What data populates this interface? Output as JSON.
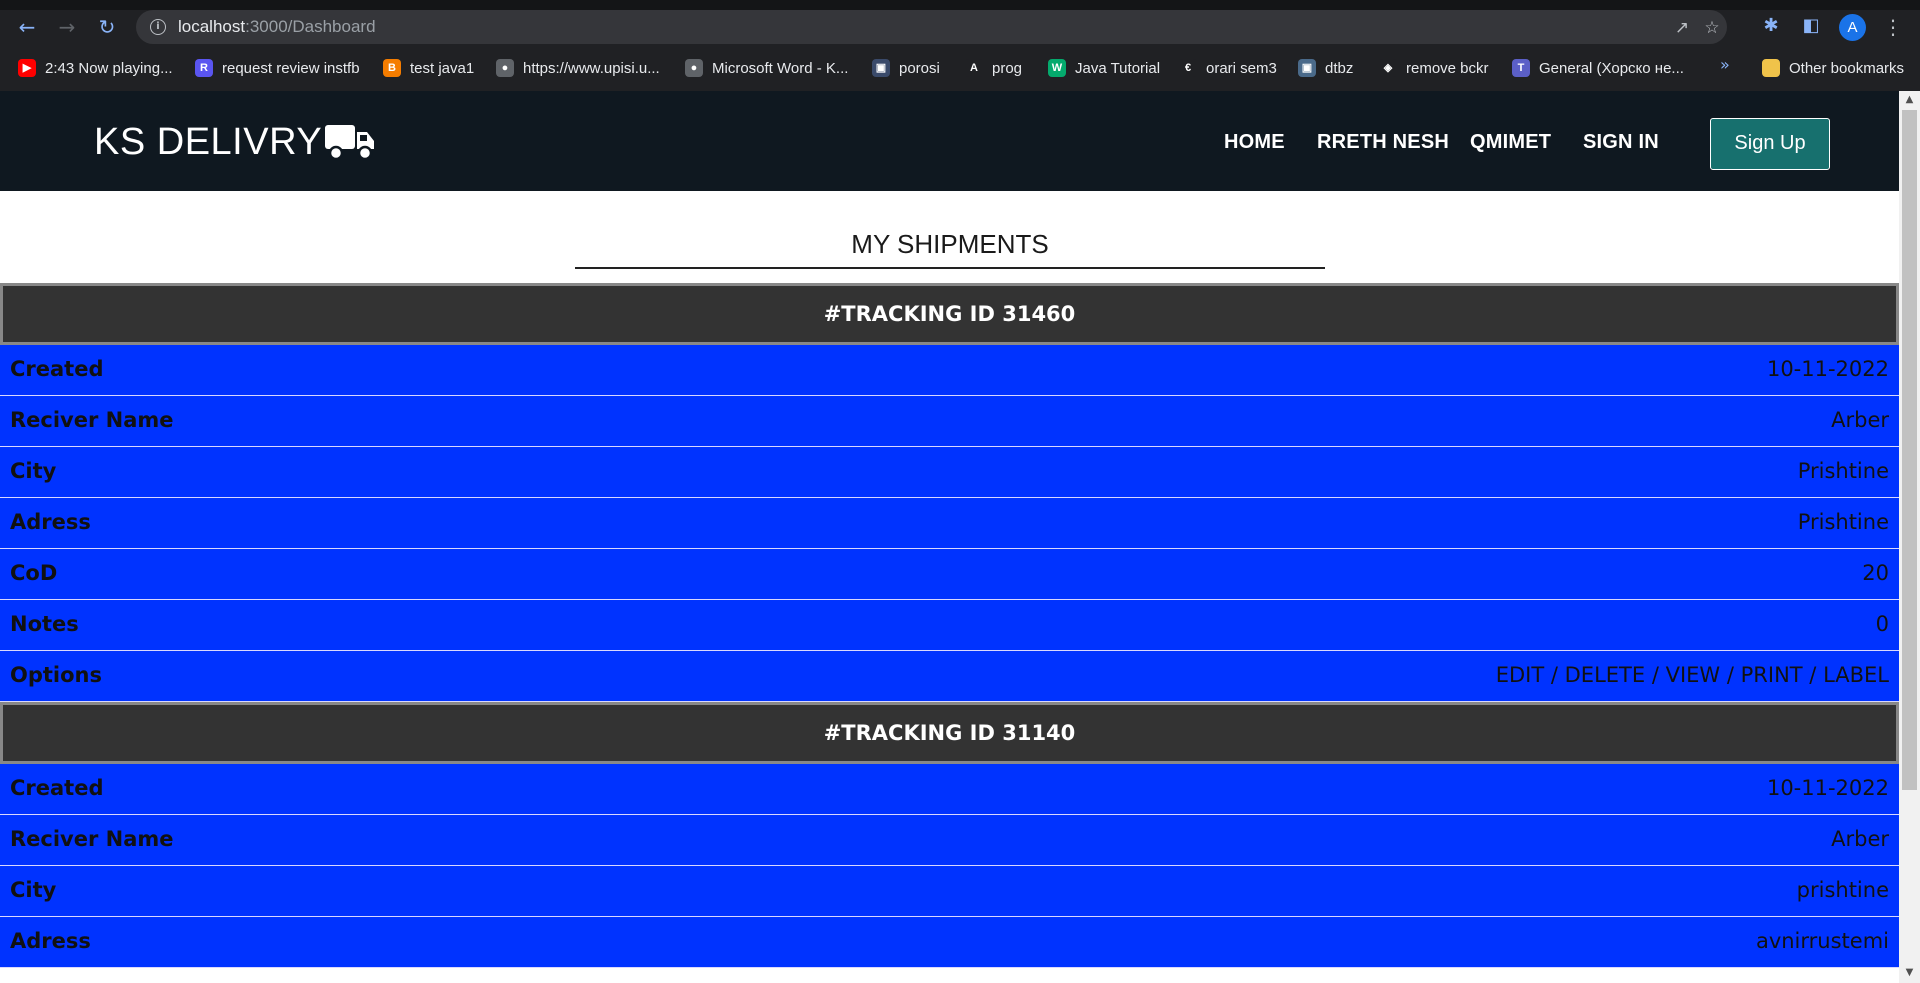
{
  "browser": {
    "url_host": "localhost",
    "url_path": ":3000/Dashboard",
    "avatar_letter": "A",
    "bookmarks": [
      {
        "label": "2:43 Now playing...",
        "icon": "youtube-icon",
        "color": "#ff0000"
      },
      {
        "label": "request review instfb",
        "icon": "request-icon",
        "color": "#5a55f0"
      },
      {
        "label": "test java1",
        "icon": "blogger-icon",
        "color": "#f57d00"
      },
      {
        "label": "https://www.upisi.u...",
        "icon": "globe-icon",
        "color": "#5f6368"
      },
      {
        "label": "Microsoft Word - K...",
        "icon": "globe-icon",
        "color": "#5f6368"
      },
      {
        "label": "porosi",
        "icon": "image-icon",
        "color": "#3a4a6a"
      },
      {
        "label": "prog",
        "icon": "angular-icon",
        "color": "#202124"
      },
      {
        "label": "Java Tutorial",
        "icon": "w3schools-icon",
        "color": "#04aa6d"
      },
      {
        "label": "orari sem3",
        "icon": "es-icon",
        "color": "#202124"
      },
      {
        "label": "dtbz",
        "icon": "image-icon",
        "color": "#4a6a8a"
      },
      {
        "label": "remove bckr",
        "icon": "layers-icon",
        "color": "#202124"
      },
      {
        "label": "General (Хорско не...",
        "icon": "teams-icon",
        "color": "#5b5fc7"
      }
    ],
    "other_bookmarks": "Other bookmarks"
  },
  "header": {
    "brand": "KS DELIVRY",
    "nav": [
      "HOME",
      "RRETH NESH",
      "QMIMET",
      "SIGN IN"
    ],
    "signup": "Sign Up"
  },
  "main": {
    "title": "MY SHIPMENTS",
    "shipments": [
      {
        "heading": "#TRACKING ID 31460",
        "rows": [
          {
            "label": "Created",
            "value": "10-11-2022"
          },
          {
            "label": "Reciver Name",
            "value": "Arber"
          },
          {
            "label": "City",
            "value": "Prishtine"
          },
          {
            "label": "Adress",
            "value": "Prishtine"
          },
          {
            "label": "CoD",
            "value": "20"
          },
          {
            "label": "Notes",
            "value": "0"
          }
        ],
        "options_label": "Options",
        "options": [
          "EDIT",
          "DELETE",
          "VIEW",
          "PRINT",
          "LABEL"
        ]
      },
      {
        "heading": "#TRACKING ID 31140",
        "rows": [
          {
            "label": "Created",
            "value": "10-11-2022"
          },
          {
            "label": "Reciver Name",
            "value": "Arber"
          },
          {
            "label": "City",
            "value": "prishtine"
          },
          {
            "label": "Adress",
            "value": "avnirrustemi"
          }
        ]
      }
    ]
  },
  "colors": {
    "row_blue": "#0033ff",
    "head_gray": "#333333",
    "nav_dark": "#0f1820",
    "signup_teal": "#17706e"
  }
}
